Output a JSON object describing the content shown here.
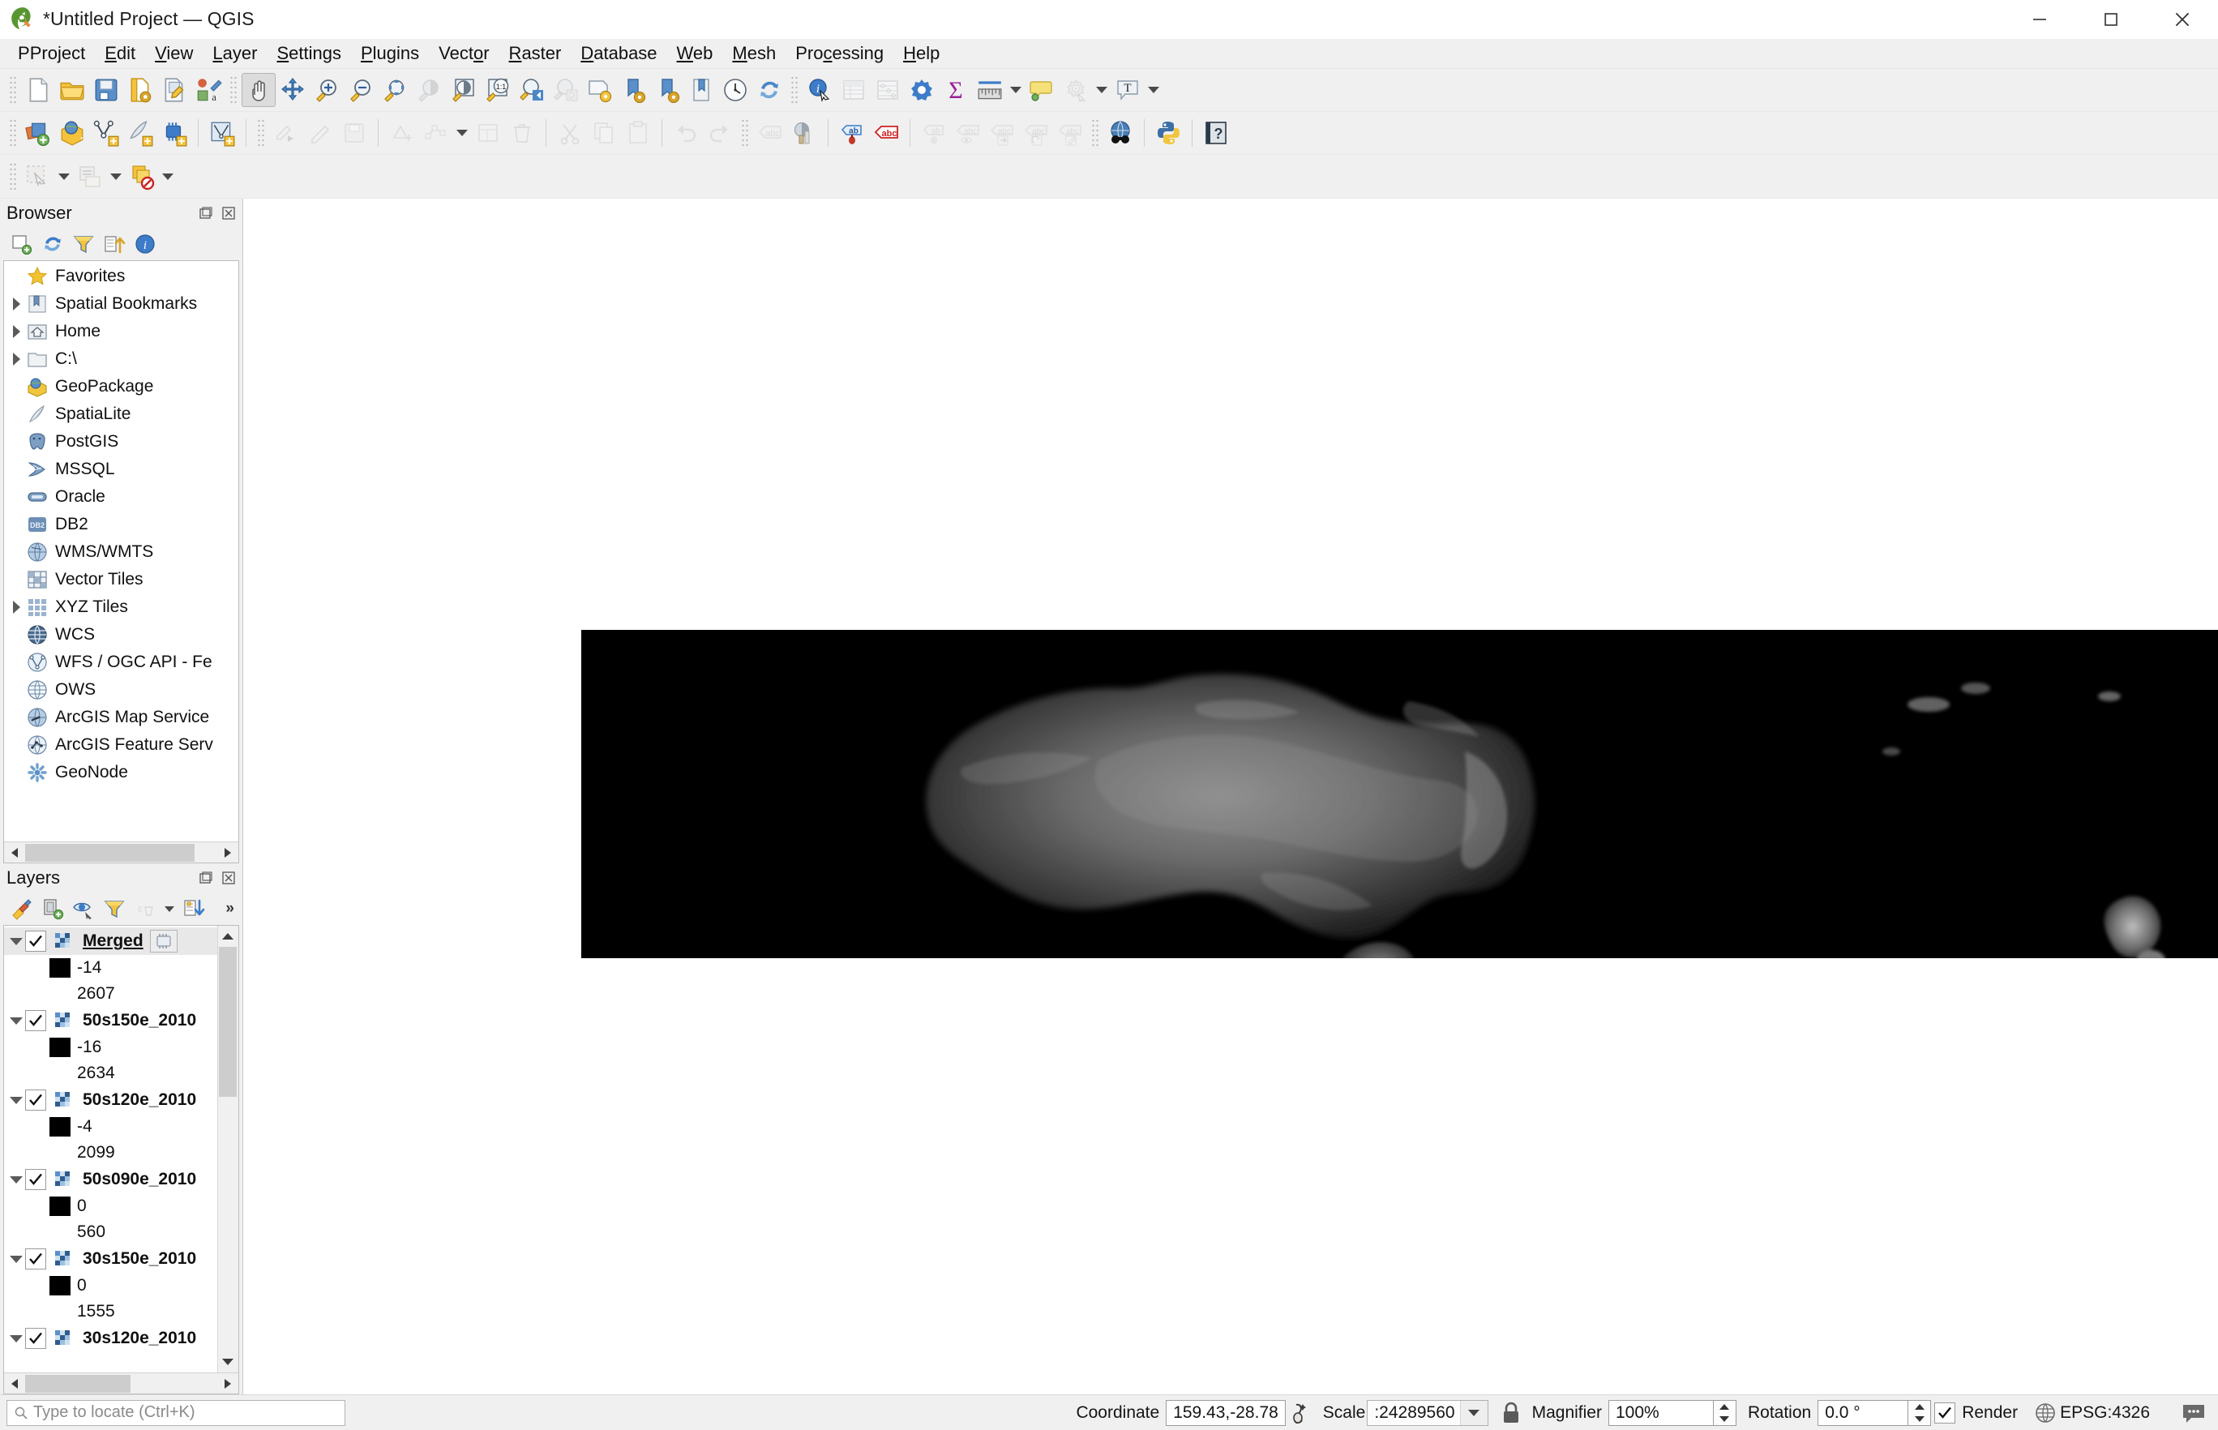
{
  "window": {
    "title": "*Untitled Project — QGIS",
    "logo_icon": "qgis-logo-icon",
    "minimize_label": "Minimize",
    "maximize_label": "Maximize",
    "close_label": "Close"
  },
  "menubar": {
    "items": [
      {
        "label": "Project",
        "mnemonic": "P"
      },
      {
        "label": "Edit",
        "mnemonic": "E"
      },
      {
        "label": "View",
        "mnemonic": "V"
      },
      {
        "label": "Layer",
        "mnemonic": "L"
      },
      {
        "label": "Settings",
        "mnemonic": "S"
      },
      {
        "label": "Plugins",
        "mnemonic": "P"
      },
      {
        "label": "Vector",
        "mnemonic": "o"
      },
      {
        "label": "Raster",
        "mnemonic": "R"
      },
      {
        "label": "Database",
        "mnemonic": "D"
      },
      {
        "label": "Web",
        "mnemonic": "W"
      },
      {
        "label": "Mesh",
        "mnemonic": "M"
      },
      {
        "label": "Processing",
        "mnemonic": "c"
      },
      {
        "label": "Help",
        "mnemonic": "H"
      }
    ]
  },
  "toolbar_project": {
    "buttons": [
      {
        "name": "new-project-icon",
        "tip": "New Project"
      },
      {
        "name": "open-project-icon",
        "tip": "Open Project"
      },
      {
        "name": "save-project-icon",
        "tip": "Save Project"
      },
      {
        "name": "new-print-layout-icon",
        "tip": "New Print Layout"
      },
      {
        "name": "layout-manager-icon",
        "tip": "Layout Manager"
      },
      {
        "name": "style-manager-icon",
        "tip": "Style Manager"
      }
    ]
  },
  "toolbar_map_nav": {
    "buttons": [
      {
        "name": "pan-map-icon",
        "tip": "Pan Map",
        "active": true
      },
      {
        "name": "pan-to-selection-icon",
        "tip": "Pan Map to Selection"
      },
      {
        "name": "zoom-in-icon",
        "tip": "Zoom In"
      },
      {
        "name": "zoom-out-icon",
        "tip": "Zoom Out"
      },
      {
        "name": "zoom-full-icon",
        "tip": "Zoom Full"
      },
      {
        "name": "zoom-selection-icon",
        "tip": "Zoom to Selection",
        "disabled": true
      },
      {
        "name": "zoom-layer-icon",
        "tip": "Zoom to Layer"
      },
      {
        "name": "zoom-native-icon",
        "tip": "Zoom to Native Resolution 1:1"
      },
      {
        "name": "zoom-last-icon",
        "tip": "Zoom Last"
      },
      {
        "name": "zoom-next-icon",
        "tip": "Zoom Next",
        "disabled": true
      },
      {
        "name": "new-map-view-icon",
        "tip": "New Map View"
      },
      {
        "name": "new-spatial-bookmark-icon",
        "tip": "New Spatial Bookmark"
      },
      {
        "name": "show-bookmarks-icon",
        "tip": "Show Spatial Bookmarks"
      },
      {
        "name": "show-bookmark-manager-icon",
        "tip": "Show Bookmark Manager"
      },
      {
        "name": "temporal-controller-icon",
        "tip": "Temporal Controller Panel"
      },
      {
        "name": "refresh-icon",
        "tip": "Refresh"
      }
    ]
  },
  "toolbar_attributes": {
    "buttons": [
      {
        "name": "identify-features-icon",
        "tip": "Identify Features"
      },
      {
        "name": "open-attribute-table-icon",
        "tip": "Open Attribute Table",
        "disabled": true
      },
      {
        "name": "statistical-summary-icon",
        "tip": "Show Statistical Summary",
        "disabled": true
      },
      {
        "name": "processing-toolbox-icon",
        "tip": "Processing Toolbox"
      },
      {
        "name": "field-calculator-icon",
        "tip": "Open Field Calculator"
      },
      {
        "name": "measure-line-icon",
        "tip": "Measure Line"
      },
      {
        "name": "map-tips-icon",
        "tip": "Show Map Tips"
      },
      {
        "name": "run-action-icon",
        "tip": "Run Feature Action",
        "disabled": true
      },
      {
        "name": "text-annotation-icon",
        "tip": "Text Annotation"
      }
    ]
  },
  "toolbar_data_source": {
    "buttons": [
      {
        "name": "add-layer-icon",
        "tip": "Open Data Source Manager"
      },
      {
        "name": "add-raster-layer-icon",
        "tip": "Add Raster Layer"
      },
      {
        "name": "add-vector-layer-icon",
        "tip": "Add Vector Layer"
      },
      {
        "name": "add-spatialite-layer-icon",
        "tip": "Add SpatiaLite Layer"
      },
      {
        "name": "add-mesh-layer-icon",
        "tip": "Add Mesh Layer"
      },
      {
        "name": "add-wfs-layer-icon",
        "tip": "Add WFS Layer"
      }
    ]
  },
  "toolbar_digitizing": {
    "buttons": [
      {
        "name": "current-edits-icon",
        "tip": "Current Edits",
        "disabled": true
      },
      {
        "name": "toggle-editing-icon",
        "tip": "Toggle Editing",
        "disabled": true
      },
      {
        "name": "save-layer-edits-icon",
        "tip": "Save Layer Edits",
        "disabled": true
      },
      {
        "name": "add-feature-icon",
        "tip": "Add Feature",
        "disabled": true
      },
      {
        "name": "vertex-tool-icon",
        "tip": "Vertex Tool",
        "disabled": true
      },
      {
        "name": "modify-attributes-icon",
        "tip": "Modify Attributes",
        "disabled": true
      },
      {
        "name": "delete-selected-icon",
        "tip": "Delete Selected",
        "disabled": true
      },
      {
        "name": "cut-features-icon",
        "tip": "Cut Features",
        "disabled": true
      },
      {
        "name": "copy-features-icon",
        "tip": "Copy Features",
        "disabled": true
      },
      {
        "name": "paste-features-icon",
        "tip": "Paste Features",
        "disabled": true
      },
      {
        "name": "undo-icon",
        "tip": "Undo",
        "disabled": true
      },
      {
        "name": "redo-icon",
        "tip": "Redo",
        "disabled": true
      }
    ]
  },
  "toolbar_label": {
    "buttons": [
      {
        "name": "layer-labeling-options-icon",
        "tip": "Layer Labeling Options",
        "disabled": true
      },
      {
        "name": "layer-diagram-options-icon",
        "tip": "Layer Diagram Options"
      },
      {
        "name": "highlight-pinned-labels-icon",
        "tip": "Highlight Pinned Labels"
      },
      {
        "name": "toggle-unplaced-labels-icon",
        "tip": "Toggle Display of Unplaced Labels"
      },
      {
        "name": "pin-labels-icon",
        "tip": "Pin/Unpin Labels",
        "disabled": true
      },
      {
        "name": "show-hide-labels-icon",
        "tip": "Show/Hide Labels",
        "disabled": true
      },
      {
        "name": "move-label-icon",
        "tip": "Move Label",
        "disabled": true
      },
      {
        "name": "rotate-label-icon",
        "tip": "Rotate Label",
        "disabled": true
      },
      {
        "name": "change-label-icon",
        "tip": "Change Label",
        "disabled": true
      }
    ]
  },
  "toolbar_plugins": {
    "buttons": [
      {
        "name": "metasearch-icon",
        "tip": "MetaSearch"
      },
      {
        "name": "python-console-icon",
        "tip": "Python Console"
      },
      {
        "name": "help-contents-icon",
        "tip": "Help Contents"
      }
    ]
  },
  "toolbar_selection": {
    "buttons": [
      {
        "name": "select-features-icon",
        "tip": "Select Features by Area or Single Click",
        "disabled": true
      },
      {
        "name": "select-by-expression-icon",
        "tip": "Select Features by Expression",
        "disabled": true
      },
      {
        "name": "deselect-features-icon",
        "tip": "Deselect Features from All Layers"
      }
    ]
  },
  "browser_panel": {
    "title": "Browser",
    "float_icon": "float-panel-icon",
    "close_icon": "close-panel-icon",
    "toolbar": [
      {
        "name": "add-selected-layers-icon",
        "tip": "Add Selected Layers"
      },
      {
        "name": "refresh-browser-icon",
        "tip": "Refresh"
      },
      {
        "name": "filter-browser-icon",
        "tip": "Filter Browser"
      },
      {
        "name": "collapse-all-icon",
        "tip": "Collapse All"
      },
      {
        "name": "browser-properties-icon",
        "tip": "Properties"
      }
    ],
    "items": [
      {
        "label": "Favorites",
        "icon": "star-icon",
        "expandable": false
      },
      {
        "label": "Spatial Bookmarks",
        "icon": "bookmark-icon",
        "expandable": true
      },
      {
        "label": "Home",
        "icon": "home-folder-icon",
        "expandable": true
      },
      {
        "label": "C:\\",
        "icon": "folder-icon",
        "expandable": true
      },
      {
        "label": "GeoPackage",
        "icon": "geopackage-icon",
        "expandable": false
      },
      {
        "label": "SpatiaLite",
        "icon": "spatialite-icon",
        "expandable": false
      },
      {
        "label": "PostGIS",
        "icon": "postgis-icon",
        "expandable": false
      },
      {
        "label": "MSSQL",
        "icon": "mssql-icon",
        "expandable": false
      },
      {
        "label": "Oracle",
        "icon": "oracle-icon",
        "expandable": false
      },
      {
        "label": "DB2",
        "icon": "db2-icon",
        "expandable": false
      },
      {
        "label": "WMS/WMTS",
        "icon": "wms-icon",
        "expandable": false
      },
      {
        "label": "Vector Tiles",
        "icon": "vector-tiles-icon",
        "expandable": false
      },
      {
        "label": "XYZ Tiles",
        "icon": "xyz-tiles-icon",
        "expandable": true
      },
      {
        "label": "WCS",
        "icon": "wcs-icon",
        "expandable": false
      },
      {
        "label": "WFS / OGC API - Fe",
        "icon": "wfs-icon",
        "expandable": false
      },
      {
        "label": "OWS",
        "icon": "ows-icon",
        "expandable": false
      },
      {
        "label": "ArcGIS Map Service",
        "icon": "arcgis-map-service-icon",
        "expandable": false
      },
      {
        "label": "ArcGIS Feature Serv",
        "icon": "arcgis-feature-service-icon",
        "expandable": false
      },
      {
        "label": "GeoNode",
        "icon": "geonode-icon",
        "expandable": false
      }
    ]
  },
  "layers_panel": {
    "title": "Layers",
    "float_icon": "float-panel-icon",
    "close_icon": "close-panel-icon",
    "toolbar": [
      {
        "name": "open-layer-styling-panel-icon",
        "tip": "Open the Layer Styling panel"
      },
      {
        "name": "add-group-icon",
        "tip": "Add Group"
      },
      {
        "name": "manage-map-themes-icon",
        "tip": "Manage Map Themes"
      },
      {
        "name": "filter-legend-icon",
        "tip": "Filter Legend"
      },
      {
        "name": "filter-legend-expression-icon",
        "tip": "Filter Legend by Expression",
        "disabled": true
      },
      {
        "name": "expand-all-icon",
        "tip": "Expand All"
      },
      {
        "name": "more-options-icon",
        "tip": "More",
        "label": "»"
      }
    ],
    "layers": [
      {
        "name": "Merged",
        "checked": true,
        "expanded": true,
        "selected": true,
        "processing_badge": true,
        "legend": [
          {
            "swatch": "#000000",
            "label": "-14"
          },
          {
            "label": "2607"
          }
        ]
      },
      {
        "name": "50s150e_2010",
        "checked": true,
        "expanded": true,
        "selected": false,
        "processing_badge": false,
        "legend": [
          {
            "swatch": "#000000",
            "label": "-16"
          },
          {
            "label": "2634"
          }
        ]
      },
      {
        "name": "50s120e_2010",
        "checked": true,
        "expanded": true,
        "selected": false,
        "processing_badge": false,
        "legend": [
          {
            "swatch": "#000000",
            "label": "-4"
          },
          {
            "label": "2099"
          }
        ]
      },
      {
        "name": "50s090e_2010",
        "checked": true,
        "expanded": true,
        "selected": false,
        "processing_badge": false,
        "legend": [
          {
            "swatch": "#000000",
            "label": "0"
          },
          {
            "label": "560"
          }
        ]
      },
      {
        "name": "30s150e_2010",
        "checked": true,
        "expanded": true,
        "selected": false,
        "processing_badge": false,
        "legend": [
          {
            "swatch": "#000000",
            "label": "0"
          },
          {
            "label": "1555"
          }
        ]
      },
      {
        "name": "30s120e_2010",
        "checked": true,
        "expanded": true,
        "selected": false,
        "processing_badge": false,
        "legend": []
      }
    ]
  },
  "map_canvas": {
    "background": "#ffffff",
    "raster_background": "#000000",
    "cursor_icon": "pan-hand-cursor",
    "description": "Grayscale DEM hillshade raster covering Australia, Tasmania and New Zealand on black nodata background"
  },
  "statusbar": {
    "locator_placeholder": "Type to locate (Ctrl+K)",
    "locator_icon": "search-icon",
    "locator_value": "",
    "coordinate_label": "Coordinate",
    "coordinate_value": "159.43,-28.78",
    "toggle_extents_icon": "toggle-extents-icon",
    "scale_label": "Scale",
    "scale_value": ":24289560",
    "lock_icon": "lock-scale-icon",
    "magnifier_label": "Magnifier",
    "magnifier_value": "100%",
    "rotation_label": "Rotation",
    "rotation_value": "0.0 °",
    "render_label": "Render",
    "render_checked": true,
    "crs_icon": "crs-globe-icon",
    "crs_label": "EPSG:4326",
    "messages_icon": "messages-icon"
  }
}
